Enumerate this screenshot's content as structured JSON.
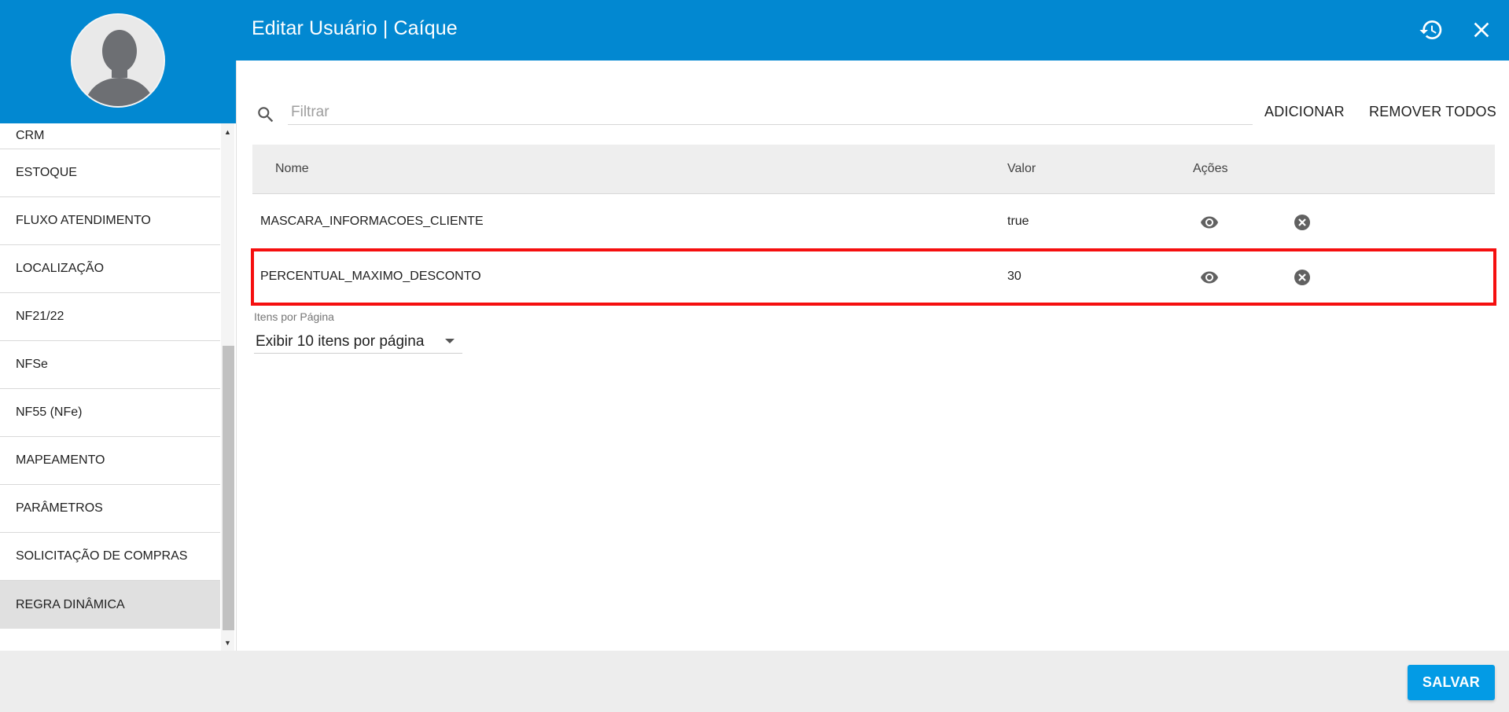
{
  "header": {
    "title": "Editar Usuário | Caíque",
    "history_icon": "history-icon",
    "close_icon": "close-icon",
    "background_color": "#0288d1"
  },
  "sidebar": {
    "avatar": "user-avatar-icon",
    "items": [
      {
        "label": "CRM"
      },
      {
        "label": "ESTOQUE"
      },
      {
        "label": "FLUXO ATENDIMENTO"
      },
      {
        "label": "LOCALIZAÇÃO"
      },
      {
        "label": "NF21/22"
      },
      {
        "label": "NFSe"
      },
      {
        "label": "NF55 (NFe)"
      },
      {
        "label": "MAPEAMENTO"
      },
      {
        "label": "PARÂMETROS"
      },
      {
        "label": "SOLICITAÇÃO DE COMPRAS"
      },
      {
        "label": "REGRA DINÂMICA",
        "active": true
      }
    ]
  },
  "toolbar": {
    "search_icon": "search-icon",
    "filter_placeholder": "Filtrar",
    "filter_value": "",
    "add_label": "ADICIONAR",
    "remove_all_label": "REMOVER TODOS"
  },
  "table": {
    "headers": {
      "name": "Nome",
      "value": "Valor",
      "actions": "Ações"
    },
    "rows": [
      {
        "name": "MASCARA_INFORMACOES_CLIENTE",
        "value": "true",
        "view_icon": "eye-icon",
        "delete_icon": "remove-circle-icon"
      },
      {
        "name": "PERCENTUAL_MAXIMO_DESCONTO",
        "value": "30",
        "view_icon": "eye-icon",
        "delete_icon": "remove-circle-icon",
        "highlighted": true
      }
    ],
    "highlight_color": "#f50f0f"
  },
  "pagination": {
    "label": "Itens por Página",
    "selected": "Exibir 10 itens por página"
  },
  "footer": {
    "save_label": "SALVAR",
    "save_color": "#039be5"
  }
}
